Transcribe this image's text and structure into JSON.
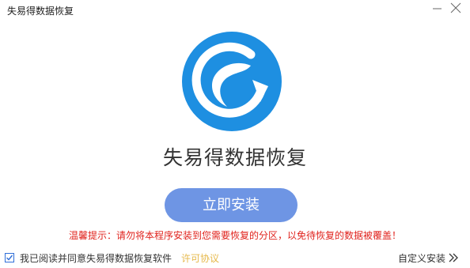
{
  "window": {
    "title": "失易得数据恢复"
  },
  "icons": {
    "minimize": "minimize-icon",
    "close": "close-icon",
    "logo": "app-logo-refresh-icon",
    "checkbox": "check-icon",
    "chevron": "double-chevron-right-icon"
  },
  "colors": {
    "brand_blue": "#1e8fe1",
    "button": "#6e95e4",
    "warning": "#e0231d",
    "link": "#e6b84a"
  },
  "main": {
    "app_name": "失易得数据恢复",
    "install_label": "立即安装",
    "warning": "温馨提示：请勿将本程序安装到您需要恢复的分区，以免待恢复的数据被覆盖！"
  },
  "footer": {
    "agree_checked": true,
    "agree_text": "我已阅读并同意失易得数据恢复软件",
    "license_link": "许可协议",
    "custom_install": "自定义安装"
  }
}
